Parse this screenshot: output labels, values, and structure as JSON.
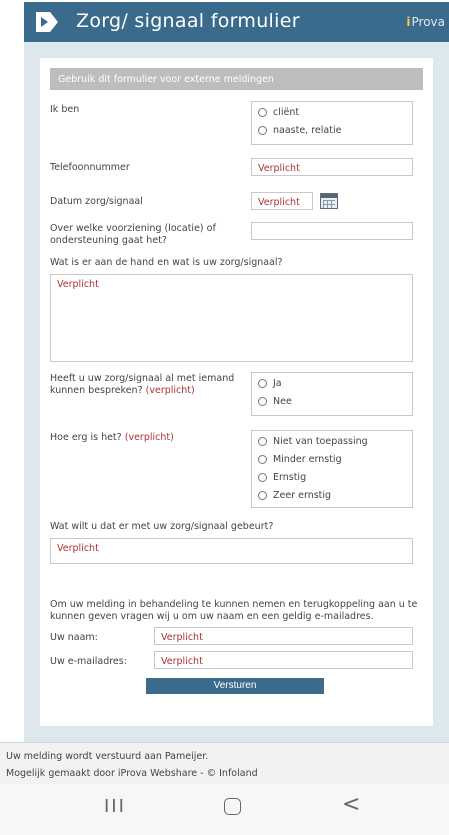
{
  "header": {
    "title": "Zorg/ signaal formulier",
    "brand_prefix": "i",
    "brand_text": "Prova"
  },
  "form": {
    "banner": "Gebruik dit formulier voor externe meldingen",
    "ik_ben": {
      "label": "Ik ben",
      "options": [
        "cliënt",
        "naaste, relatie"
      ]
    },
    "telefoon": {
      "label": "Telefoonnummer",
      "placeholder": "Verplicht"
    },
    "datum": {
      "label": "Datum zorg/signaal",
      "placeholder": "Verplicht"
    },
    "voorziening": {
      "label": "Over welke voorziening (locatie) of ondersteuning gaat het?",
      "value": ""
    },
    "aan_de_hand": {
      "label": "Wat is er aan de hand en wat is uw zorg/signaal?",
      "placeholder": "Verplicht"
    },
    "besproken": {
      "label": "Heeft u uw zorg/signaal al met iemand kunnen bespreken?",
      "required": "(verplicht)",
      "options": [
        "Ja",
        "Nee"
      ]
    },
    "ernst": {
      "label": "Hoe erg is het?",
      "required": "(verplicht)",
      "options": [
        "Niet van toepassing",
        "Minder ernstig",
        "Ernstig",
        "Zeer ernstig"
      ]
    },
    "wat_wilt_u": {
      "label": "Wat wilt u dat er met uw zorg/signaal gebeurt?",
      "placeholder": "Verplicht"
    },
    "info_text": "Om uw melding in behandeling te kunnen nemen en terugkoppeling aan u te kunnen geven vragen wij u om uw naam en een geldig e-mailadres.",
    "naam": {
      "label": "Uw naam:",
      "placeholder": "Verplicht"
    },
    "email": {
      "label": "Uw e-mailadres:",
      "placeholder": "Verplicht"
    },
    "submit_label": "Versturen"
  },
  "footer": {
    "line1": "Uw melding wordt verstuurd aan Pameijer.",
    "line2": "Mogelijk gemaakt door iProva Webshare - © Infoland"
  },
  "navbar": {
    "recent_glyph": "III",
    "back_glyph": "<"
  },
  "icons": {
    "logo": "iprova-logo-icon",
    "calendar": "calendar-icon",
    "recent": "recent-apps-icon",
    "home": "home-icon",
    "back": "back-icon"
  },
  "colors": {
    "header": "#3a6a8c",
    "required": "#aa3333",
    "frame": "#dde7ee",
    "banner": "#bdbdbd"
  }
}
